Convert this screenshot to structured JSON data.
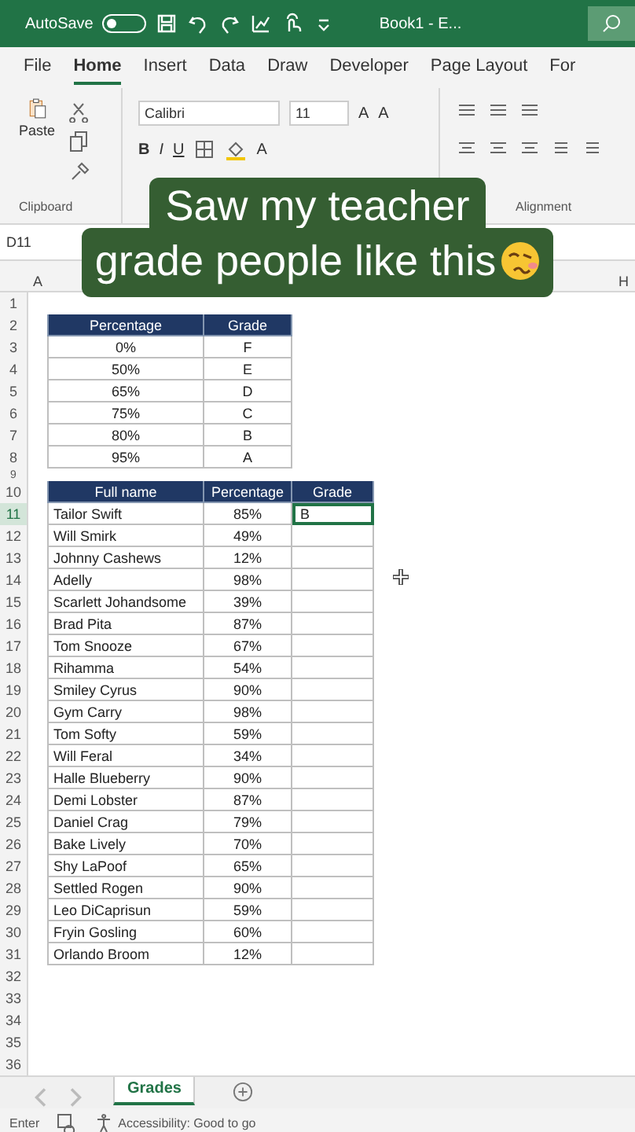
{
  "title_bar": {
    "autosave_label": "AutoSave",
    "autosave_on": false,
    "title": "Book1 - E..."
  },
  "ribbon_tabs": [
    {
      "label": "File",
      "selected": false
    },
    {
      "label": "Home",
      "selected": true
    },
    {
      "label": "Insert",
      "selected": false
    },
    {
      "label": "Data",
      "selected": false
    },
    {
      "label": "Draw",
      "selected": false
    },
    {
      "label": "Developer",
      "selected": false
    },
    {
      "label": "Page Layout",
      "selected": false
    },
    {
      "label": "For",
      "selected": false
    }
  ],
  "ribbon": {
    "paste_label": "Paste",
    "font_name": "Calibri",
    "font_size": "11",
    "grow_font": "A",
    "shrink_font": "A",
    "bold": "B",
    "italic": "I",
    "underline": "U",
    "font_color": "A",
    "groups": [
      "Clipboard",
      "Alignment"
    ]
  },
  "caption": {
    "lines": [
      "Saw my teacher",
      "grade people like this"
    ]
  },
  "name_box": "D11",
  "column_headers": [
    "A",
    "H"
  ],
  "sheet_rows": [
    {
      "number": "1",
      "kind": "empty"
    },
    {
      "number": "2",
      "kind": "header",
      "cells": [
        "Percentage",
        "Grade"
      ]
    },
    {
      "number": "3",
      "kind": "lookup",
      "cells": [
        "0%",
        "F"
      ]
    },
    {
      "number": "4",
      "kind": "lookup",
      "cells": [
        "50%",
        "E"
      ]
    },
    {
      "number": "5",
      "kind": "lookup",
      "cells": [
        "65%",
        "D"
      ]
    },
    {
      "number": "6",
      "kind": "lookup",
      "cells": [
        "75%",
        "C"
      ]
    },
    {
      "number": "7",
      "kind": "lookup",
      "cells": [
        "80%",
        "B"
      ]
    },
    {
      "number": "8",
      "kind": "lookup",
      "cells": [
        "95%",
        "A"
      ]
    },
    {
      "number": "9",
      "kind": "spacer"
    },
    {
      "number": "10",
      "kind": "header",
      "cells": [
        "Full name",
        "Percentage",
        "Grade"
      ]
    },
    {
      "number": "11",
      "kind": "student",
      "name": "Tailor Swift",
      "percentage": "85%",
      "grade": "B",
      "selected": true
    },
    {
      "number": "12",
      "kind": "student",
      "name": "Will Smirk",
      "percentage": "49%",
      "selected": false
    },
    {
      "number": "13",
      "kind": "student",
      "name": "Johnny Cashews",
      "percentage": "12%",
      "selected": false
    },
    {
      "number": "14",
      "kind": "student",
      "name": "Adelly",
      "percentage": "98%",
      "selected": false
    },
    {
      "number": "15",
      "kind": "student",
      "name": "Scarlett Johandsome",
      "percentage": "39%",
      "selected": false
    },
    {
      "number": "16",
      "kind": "student",
      "name": "Brad Pita",
      "percentage": "87%",
      "selected": false
    },
    {
      "number": "17",
      "kind": "student",
      "name": "Tom Snooze",
      "percentage": "67%",
      "selected": false
    },
    {
      "number": "18",
      "kind": "student",
      "name": "Rihamma",
      "percentage": "54%",
      "selected": false
    },
    {
      "number": "19",
      "kind": "student",
      "name": "Smiley Cyrus",
      "percentage": "90%",
      "selected": false
    },
    {
      "number": "20",
      "kind": "student",
      "name": "Gym Carry",
      "percentage": "98%",
      "selected": false
    },
    {
      "number": "21",
      "kind": "student",
      "name": "Tom Softy",
      "percentage": "59%",
      "selected": false
    },
    {
      "number": "22",
      "kind": "student",
      "name": "Will Feral",
      "percentage": "34%",
      "selected": false
    },
    {
      "number": "23",
      "kind": "student",
      "name": "Halle Blueberry",
      "percentage": "90%",
      "selected": false
    },
    {
      "number": "24",
      "kind": "student",
      "name": "Demi Lobster",
      "percentage": "87%",
      "selected": false
    },
    {
      "number": "25",
      "kind": "student",
      "name": "Daniel Crag",
      "percentage": "79%",
      "selected": false
    },
    {
      "number": "26",
      "kind": "student",
      "name": "Bake Lively",
      "percentage": "70%",
      "selected": false
    },
    {
      "number": "27",
      "kind": "student",
      "name": "Shy LaPoof",
      "percentage": "65%",
      "selected": false
    },
    {
      "number": "28",
      "kind": "student",
      "name": "Settled Rogen",
      "percentage": "90%",
      "selected": false
    },
    {
      "number": "29",
      "kind": "student",
      "name": "Leo DiCaprisun",
      "percentage": "59%",
      "selected": false
    },
    {
      "number": "30",
      "kind": "student",
      "name": "Fryin Gosling",
      "percentage": "60%",
      "selected": false
    },
    {
      "number": "31",
      "kind": "student",
      "name": "Orlando Broom",
      "percentage": "12%",
      "selected": false
    },
    {
      "number": "32",
      "kind": "empty"
    },
    {
      "number": "33",
      "kind": "empty"
    },
    {
      "number": "34",
      "kind": "empty"
    },
    {
      "number": "35",
      "kind": "empty"
    },
    {
      "number": "36",
      "kind": "empty"
    }
  ],
  "sheet_tabs": [
    {
      "label": "Grades",
      "selected": true
    }
  ],
  "status_bar": {
    "mode": "Enter",
    "accessibility": "Accessibility: Good to go"
  }
}
